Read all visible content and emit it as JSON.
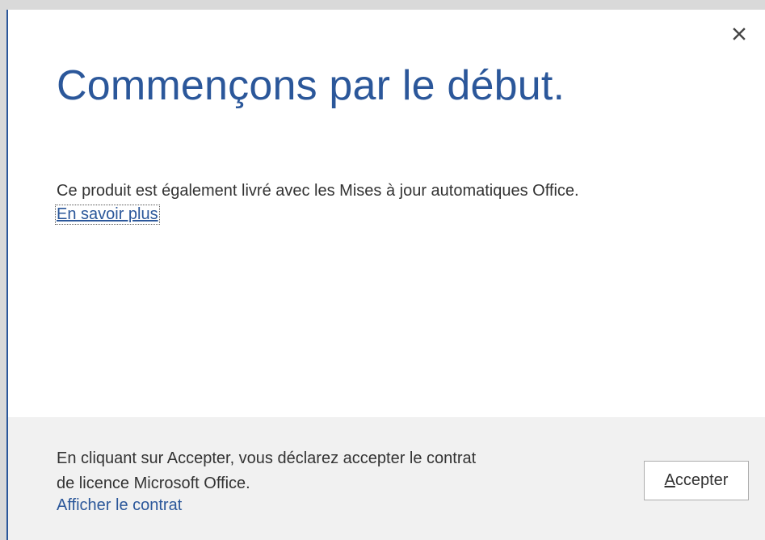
{
  "dialog": {
    "heading": "Commençons par le début.",
    "close_icon": "close-icon",
    "body_text": "Ce produit est également livré avec les Mises à jour automatiques Office.",
    "learn_more_link": "En savoir plus"
  },
  "footer": {
    "license_line1": "En cliquant sur Accepter, vous déclarez accepter le contrat",
    "license_line2": "de licence Microsoft Office.",
    "view_contract_link": "Afficher le contrat",
    "accept_button": {
      "mnemonic": "A",
      "rest": "ccepter"
    }
  },
  "colors": {
    "accent": "#2b579a",
    "footer_bg": "#f1f1f1",
    "text": "#333333"
  }
}
